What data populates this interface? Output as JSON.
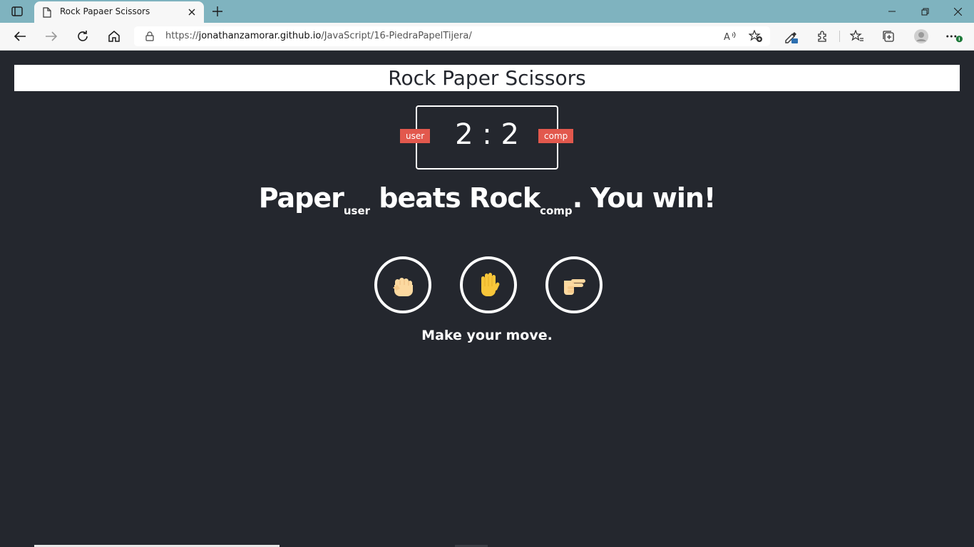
{
  "browser": {
    "tab_title": "Rock Papaer Scissors",
    "url_prefix": "https://",
    "url_host": "jonathanzamorar.github.io",
    "url_path": "/JavaScript/16-PiedraPapelTijera/",
    "icons": [
      "tab-actions-icon",
      "page-icon",
      "close-icon",
      "plus-icon",
      "minimize-icon",
      "restore-icon",
      "close-window-icon",
      "back-icon",
      "forward-icon",
      "refresh-icon",
      "home-icon",
      "lock-icon",
      "read-aloud-icon",
      "add-favorite-icon",
      "eyedropper-icon",
      "extensions-icon",
      "favorites-icon",
      "collections-icon",
      "profile-icon",
      "more-icon"
    ]
  },
  "page": {
    "title": "Rock Paper Scissors",
    "score": {
      "user_score": "2",
      "separator": ":",
      "comp_score": "2",
      "user_label": "user",
      "comp_label": "comp"
    },
    "result": {
      "user_choice": "Paper",
      "user_tag": "user",
      "verb": "beats",
      "comp_choice": "Rock",
      "comp_tag": "comp",
      "outcome": ". You win!"
    },
    "choices": [
      "rock",
      "paper",
      "scissors"
    ],
    "prompt": "Make your move.",
    "colors": {
      "background": "#24272e",
      "badge": "#e2584d",
      "hand_skin": "#fcd9a0",
      "hand_yellow": "#f8c63a",
      "chrome": "#7fb3bf"
    }
  }
}
